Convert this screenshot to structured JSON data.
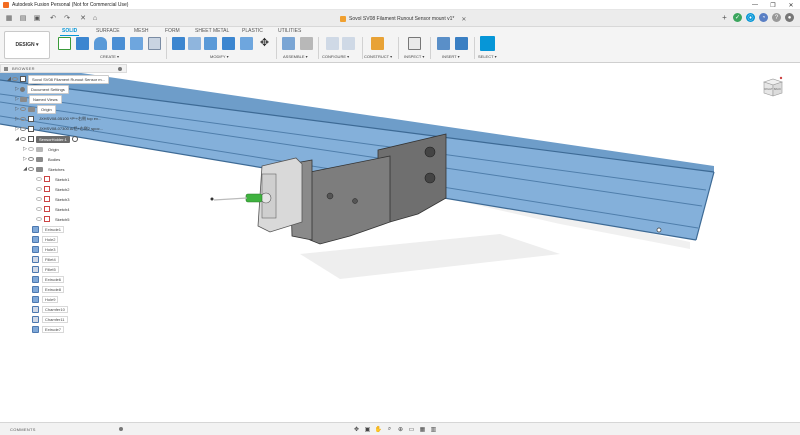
{
  "window": {
    "title": "Autodesk Fusion Personal (Not for Commercial Use)",
    "controls": [
      "—",
      "❐",
      "✕"
    ]
  },
  "document_tab": {
    "name": "Sovol SV08 Filament Runout Sensor mount v1*",
    "close": "✕"
  },
  "ribbon": {
    "workspace_label": "DESIGN ▾",
    "tabs": [
      "SOLID",
      "SURFACE",
      "MESH",
      "FORM",
      "SHEET METAL",
      "PLASTIC",
      "UTILITIES"
    ],
    "active_tab": "SOLID",
    "groups": [
      "CREATE ▾",
      "MODIFY ▾",
      "ASSEMBLE ▾",
      "CONFIGURE ▾",
      "CONSTRUCT ▾",
      "INSPECT ▾",
      "INSERT ▾",
      "SELECT ▾"
    ],
    "accent_color": "#0696d7"
  },
  "browser": {
    "header": "BROWSER",
    "items": [
      {
        "label": "Sovol SV08 Filament Runout Sensor m...",
        "style": "boxed"
      },
      {
        "label": "Document Settings",
        "style": "boxed"
      },
      {
        "label": "Named Views",
        "style": "boxed"
      },
      {
        "label": "Origin",
        "style": "boxed"
      },
      {
        "label": "JXHSV08-05100 *P*+右侧 top ex...",
        "style": "plain"
      },
      {
        "label": "JXHSV08-07300 AI铝+右侧2 spoc...",
        "style": "plain"
      },
      {
        "label": "SensorHolder:1",
        "style": "selected"
      },
      {
        "label": "Origin",
        "style": "plain"
      },
      {
        "label": "Bodies",
        "style": "plain"
      },
      {
        "label": "Sketches",
        "style": "plain"
      },
      {
        "label": "Sketch1",
        "style": "plain"
      },
      {
        "label": "Sketch2",
        "style": "plain"
      },
      {
        "label": "Sketch3",
        "style": "plain"
      },
      {
        "label": "Sketch4",
        "style": "plain"
      },
      {
        "label": "Sketch5",
        "style": "plain"
      }
    ]
  },
  "timeline_features": [
    {
      "label": "Extrude1",
      "kind": "extrude"
    },
    {
      "label": "Hole2",
      "kind": "hole"
    },
    {
      "label": "Hole3",
      "kind": "hole"
    },
    {
      "label": "Fillet4",
      "kind": "fillet"
    },
    {
      "label": "Fillet5",
      "kind": "fillet"
    },
    {
      "label": "Extrude6",
      "kind": "extrude"
    },
    {
      "label": "Extrude8",
      "kind": "extrude"
    },
    {
      "label": "Hole9",
      "kind": "hole"
    },
    {
      "label": "Chamfer10",
      "kind": "chamfer"
    },
    {
      "label": "Chamfer11",
      "kind": "chamfer"
    },
    {
      "label": "Extrude7",
      "kind": "extrude"
    }
  ],
  "viewcube": {
    "faces": [
      "RIGHT",
      "BACK"
    ]
  },
  "bottom": {
    "comments_label": "COMMENTS"
  },
  "colors": {
    "rail_blue": "#7fa9d3",
    "part_gray": "#7c7c7c",
    "sensor_green": "#3fb23f"
  }
}
